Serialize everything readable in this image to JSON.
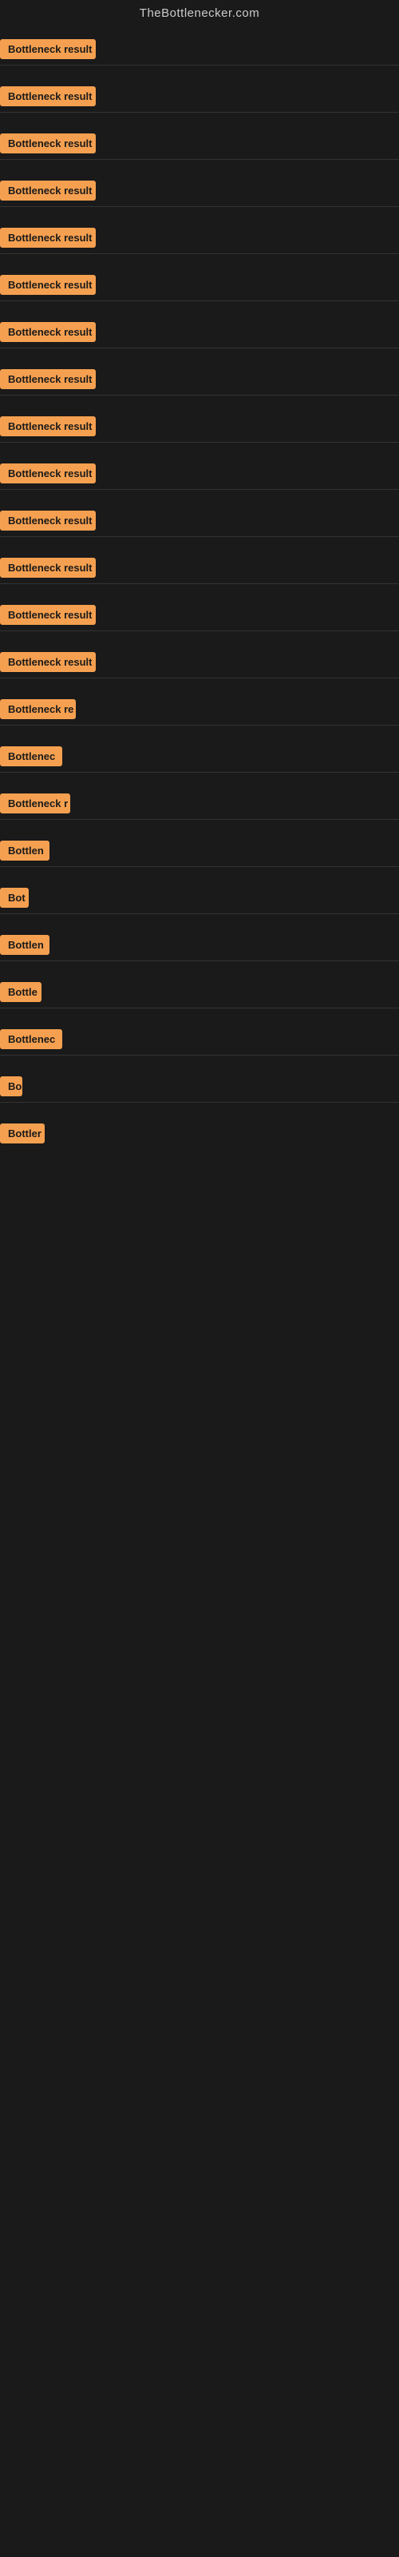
{
  "header": {
    "title": "TheBottlenecker.com"
  },
  "items": [
    {
      "id": 1,
      "label": "Bottleneck result",
      "width": 120
    },
    {
      "id": 2,
      "label": "Bottleneck result",
      "width": 120
    },
    {
      "id": 3,
      "label": "Bottleneck result",
      "width": 120
    },
    {
      "id": 4,
      "label": "Bottleneck result",
      "width": 120
    },
    {
      "id": 5,
      "label": "Bottleneck result",
      "width": 120
    },
    {
      "id": 6,
      "label": "Bottleneck result",
      "width": 120
    },
    {
      "id": 7,
      "label": "Bottleneck result",
      "width": 120
    },
    {
      "id": 8,
      "label": "Bottleneck result",
      "width": 120
    },
    {
      "id": 9,
      "label": "Bottleneck result",
      "width": 120
    },
    {
      "id": 10,
      "label": "Bottleneck result",
      "width": 120
    },
    {
      "id": 11,
      "label": "Bottleneck result",
      "width": 120
    },
    {
      "id": 12,
      "label": "Bottleneck result",
      "width": 120
    },
    {
      "id": 13,
      "label": "Bottleneck result",
      "width": 120
    },
    {
      "id": 14,
      "label": "Bottleneck result",
      "width": 120
    },
    {
      "id": 15,
      "label": "Bottleneck re",
      "width": 95
    },
    {
      "id": 16,
      "label": "Bottlenec",
      "width": 78
    },
    {
      "id": 17,
      "label": "Bottleneck r",
      "width": 88
    },
    {
      "id": 18,
      "label": "Bottlen",
      "width": 62
    },
    {
      "id": 19,
      "label": "Bot",
      "width": 36
    },
    {
      "id": 20,
      "label": "Bottlen",
      "width": 62
    },
    {
      "id": 21,
      "label": "Bottle",
      "width": 52
    },
    {
      "id": 22,
      "label": "Bottlenec",
      "width": 78
    },
    {
      "id": 23,
      "label": "Bo",
      "width": 28
    },
    {
      "id": 24,
      "label": "Bottler",
      "width": 56
    }
  ]
}
